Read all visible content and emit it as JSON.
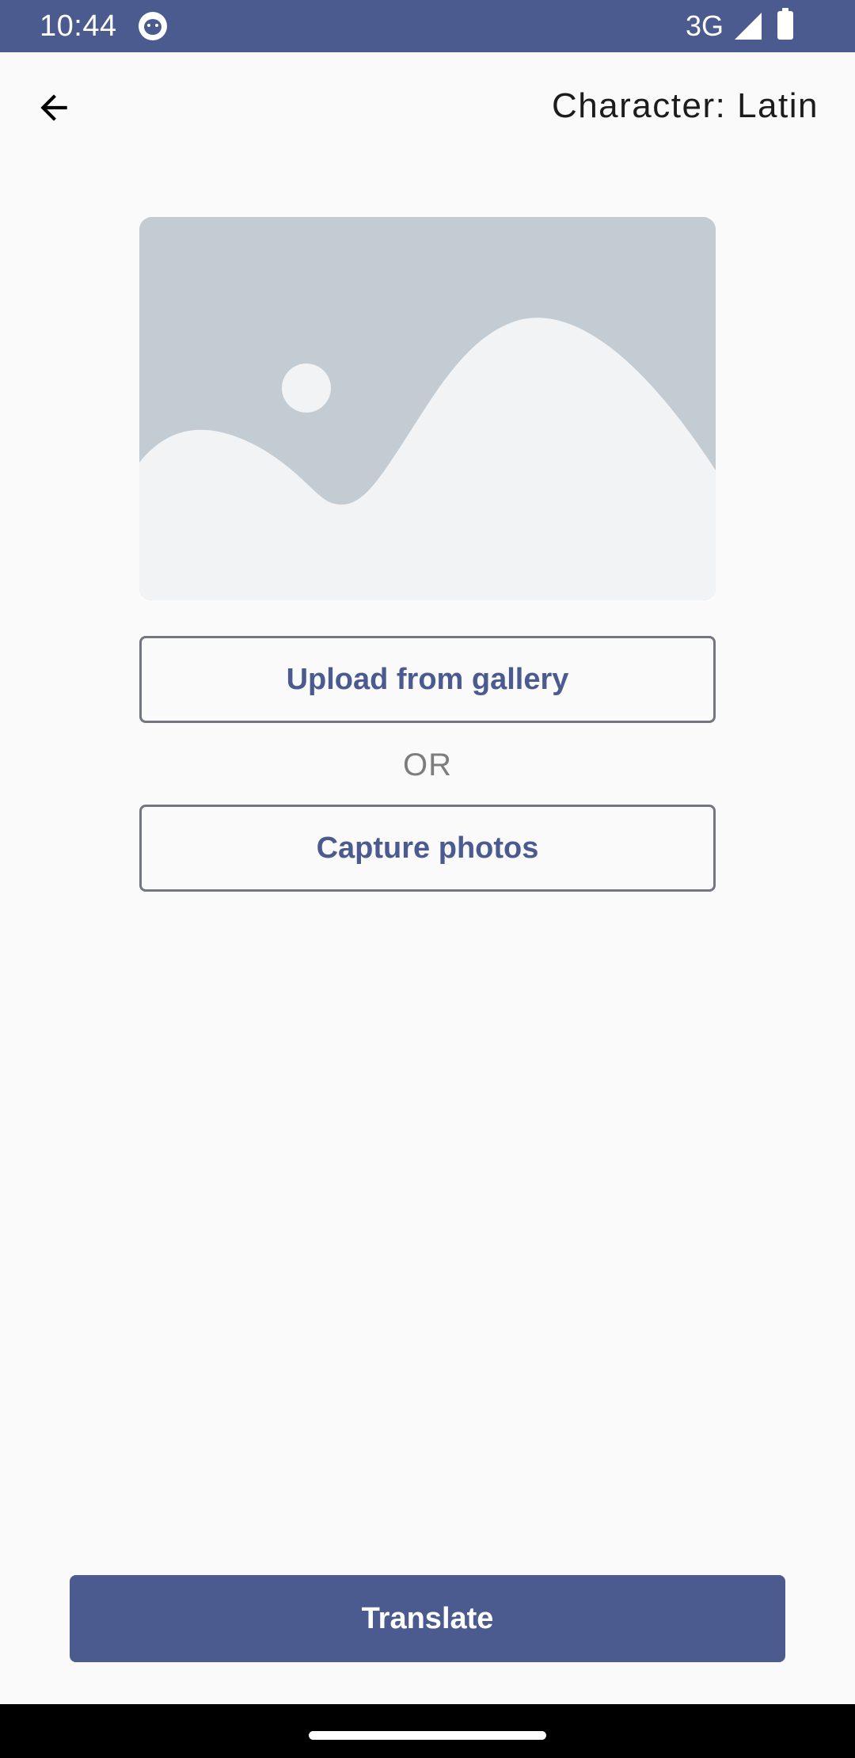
{
  "status_bar": {
    "time": "10:44",
    "network": "3G",
    "icons": [
      "app-notification-icon",
      "signal-icon",
      "battery-icon"
    ]
  },
  "app_bar": {
    "back_icon": "arrow-back-icon",
    "title": "Character: Latin"
  },
  "image_preview": {
    "icon": "image-placeholder-icon"
  },
  "actions": {
    "upload_label": "Upload from gallery",
    "separator": "OR",
    "capture_label": "Capture photos"
  },
  "footer": {
    "translate_label": "Translate"
  },
  "colors": {
    "primary": "#4b5b8f",
    "background": "#fafafa",
    "placeholder_bg": "#c3cbd3",
    "placeholder_fg": "#f2f3f5",
    "outline": "#73767f",
    "or_text": "#7d7d7d"
  }
}
